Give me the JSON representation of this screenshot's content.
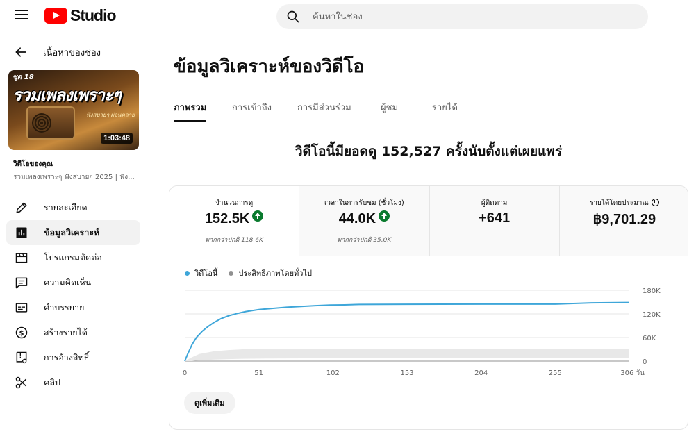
{
  "app": {
    "logo_text": "Studio"
  },
  "search": {
    "placeholder": "ค้นหาในช่อง"
  },
  "sidebar": {
    "back_label": "เนื้อหาของช่อง",
    "thumbnail": {
      "tag": "ชุด 18",
      "title": "รวมเพลงเพราะๆ",
      "subtitle": "ฟังสบายๆ ผ่อนคลาย",
      "duration": "1:03:48"
    },
    "your_video_label": "วิดีโอของคุณ",
    "video_name": "รวมเพลงเพราะๆ ฟังสบายๆ 2025 | ฟัง...",
    "items": [
      {
        "label": "รายละเอียด",
        "icon": "pencil-icon"
      },
      {
        "label": "ข้อมูลวิเคราะห์",
        "icon": "analytics-icon",
        "active": true
      },
      {
        "label": "โปรแกรมตัดต่อ",
        "icon": "clapperboard-icon"
      },
      {
        "label": "ความคิดเห็น",
        "icon": "comment-icon"
      },
      {
        "label": "คำบรรยาย",
        "icon": "subtitles-icon"
      },
      {
        "label": "สร้างรายได้",
        "icon": "dollar-icon"
      },
      {
        "label": "การอ้างสิทธิ์",
        "icon": "copyright-claim-icon"
      },
      {
        "label": "คลิป",
        "icon": "scissors-icon"
      }
    ]
  },
  "main": {
    "title": "ข้อมูลวิเคราะห์ของวิดีโอ",
    "tabs": [
      {
        "label": "ภาพรวม",
        "active": true
      },
      {
        "label": "การเข้าถึง"
      },
      {
        "label": "การมีส่วนร่วม"
      },
      {
        "label": "ผู้ชม"
      },
      {
        "label": "รายได้"
      }
    ],
    "headline": "วิดีโอนี้มียอดดู 152,527 ครั้งนับตั้งแต่เผยแพร่",
    "metrics": [
      {
        "label": "จำนวนการดู",
        "value": "152.5K",
        "trend": "up",
        "sub": "มากกว่าปกติ 118.6K",
        "active": true
      },
      {
        "label": "เวลาในการรับชม (ชั่วโมง)",
        "value": "44.0K",
        "trend": "up",
        "sub": "มากกว่าปกติ 35.0K"
      },
      {
        "label": "ผู้ติดตาม",
        "value": "+641"
      },
      {
        "label": "รายได้โดยประมาณ",
        "value": "฿9,701.29",
        "icon": "clock-icon"
      }
    ],
    "legend": [
      {
        "label": "วิดีโอนี้",
        "color": "#3ea6d9"
      },
      {
        "label": "ประสิทธิภาพโดยทั่วไป",
        "color": "#909090"
      }
    ],
    "more_button": "ดูเพิ่มเติม"
  },
  "chart_data": {
    "type": "line",
    "x_ticks": [
      "0",
      "51",
      "102",
      "153",
      "204",
      "255",
      "306 วัน"
    ],
    "y_ticks": [
      "180K",
      "120K",
      "60K",
      "0"
    ],
    "ylim": [
      0,
      180000
    ],
    "xlim": [
      0,
      306
    ],
    "series": [
      {
        "name": "วิดีโอนี้",
        "color": "#3ea6d9",
        "x": [
          0,
          2,
          5,
          8,
          12,
          16,
          20,
          25,
          30,
          36,
          42,
          51,
          60,
          70,
          80,
          90,
          100,
          110,
          120,
          153,
          204,
          255,
          280,
          306
        ],
        "y": [
          0,
          18000,
          42000,
          60000,
          76000,
          88000,
          98000,
          108000,
          115000,
          121000,
          126000,
          131000,
          134000,
          137000,
          139000,
          141000,
          142500,
          143000,
          144000,
          144500,
          145000,
          145000,
          148000,
          149000
        ]
      },
      {
        "name": "ประสิทธิภาพโดยทั่วไป",
        "color": "#e8e8e8",
        "x": [
          0,
          5,
          10,
          20,
          30,
          40,
          51,
          80,
          120,
          306
        ],
        "lower": [
          0,
          0,
          2000,
          4000,
          5000,
          6000,
          6500,
          7000,
          7000,
          7000
        ],
        "upper": [
          0,
          10000,
          18000,
          25000,
          28000,
          30000,
          31000,
          31000,
          31000,
          31000
        ]
      }
    ],
    "grid": true
  }
}
